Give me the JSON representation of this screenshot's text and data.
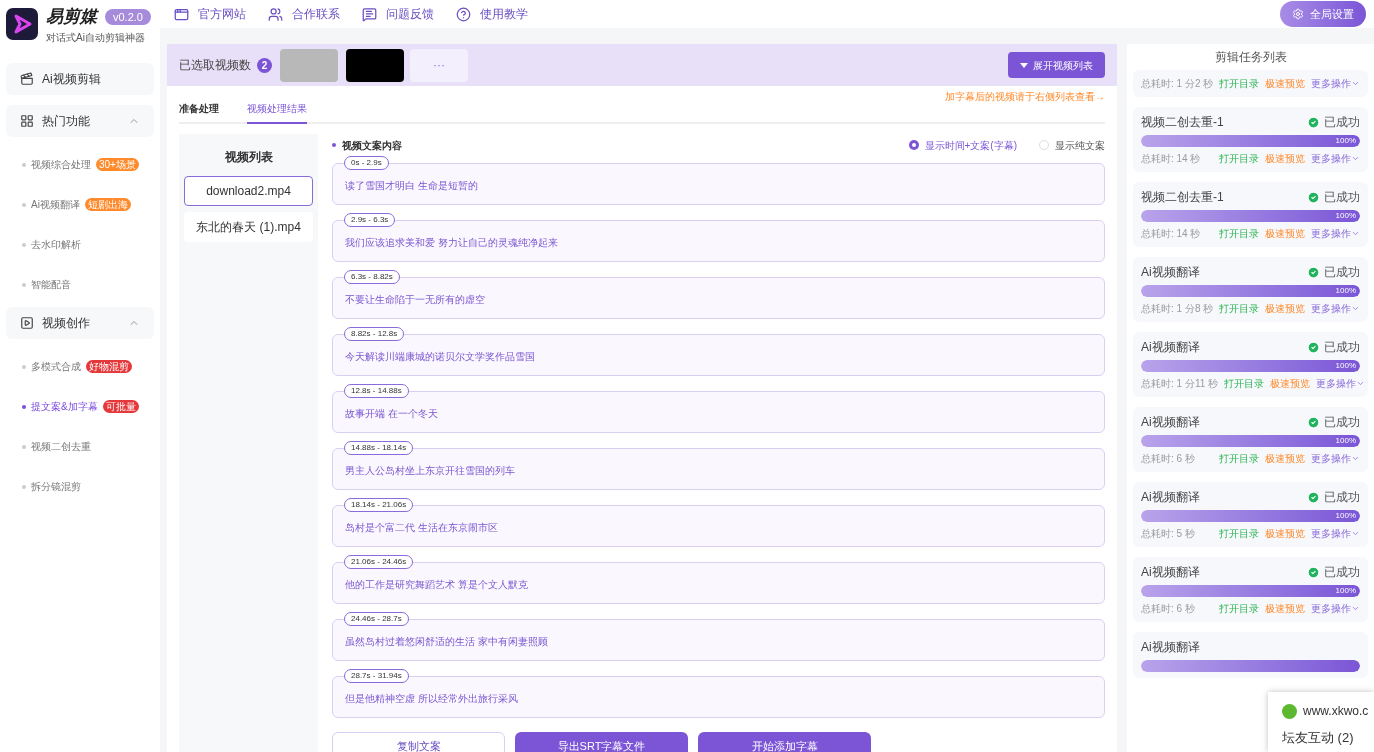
{
  "brand": {
    "name": "易剪媒",
    "version": "v0.2.0",
    "tagline": "对话式Ai自动剪辑神器"
  },
  "sidebar": [
    {
      "kind": "link",
      "label": "Ai视频剪辑"
    },
    {
      "kind": "group",
      "label": "热门功能",
      "expanded": true,
      "children": [
        {
          "label": "视频综合处理",
          "selected": false,
          "badge": "30+场景",
          "color": "#ff8a2b"
        },
        {
          "label": "Ai视频翻译",
          "selected": false,
          "badge": "短剧出海",
          "color": "#ff8a2b"
        },
        {
          "label": "去水印解析",
          "selected": false
        },
        {
          "label": "智能配音",
          "selected": false
        }
      ]
    },
    {
      "kind": "group",
      "label": "视频创作",
      "expanded": true,
      "children": [
        {
          "label": "多模式合成",
          "selected": false,
          "badge": "好物混剪",
          "color": "#e5383b"
        },
        {
          "label": "提文案&加字幕",
          "selected": true,
          "badge": "可批量",
          "color": "#e5383b"
        },
        {
          "label": "视频二创去重",
          "selected": false
        },
        {
          "label": "拆分镜混剪",
          "selected": false
        }
      ]
    }
  ],
  "topnav": [
    {
      "label": "官方网站"
    },
    {
      "label": "合作联系"
    },
    {
      "label": "问题反馈"
    },
    {
      "label": "使用教学"
    }
  ],
  "settings_button": "全局设置",
  "selection": {
    "label": "已选取视频数",
    "count": "2",
    "thumbnails": [
      {
        "kind": "photo"
      },
      {
        "kind": "dark"
      }
    ],
    "more": "···",
    "expand_button": "展开视频列表"
  },
  "tabs": [
    {
      "label": "准备处理",
      "selected": false
    },
    {
      "label": "视频处理结果",
      "selected": true
    }
  ],
  "hint": "加字幕后的视频请于右侧列表查看→",
  "video_list": {
    "title": "视频列表",
    "items": [
      {
        "label": "download2.mp4",
        "selected": true
      },
      {
        "label": "东北的春天 (1).mp4",
        "selected": false
      }
    ]
  },
  "transcript": {
    "title": "视频文案内容",
    "options": [
      {
        "label": "显示时间+文案(字幕)",
        "selected": true
      },
      {
        "label": "显示纯文案",
        "selected": false
      }
    ],
    "segments": [
      {
        "time": "0s - 2.9s",
        "text": "读了雪国才明白 生命是短暂的"
      },
      {
        "time": "2.9s - 6.3s",
        "text": "我们应该追求美和爱 努力让自己的灵魂纯净起来"
      },
      {
        "time": "6.3s - 8.82s",
        "text": "不要让生命陷于一无所有的虚空"
      },
      {
        "time": "8.82s - 12.8s",
        "text": "今天解读川端康城的诺贝尔文学奖作品雪国"
      },
      {
        "time": "12.8s - 14.88s",
        "text": "故事开端 在一个冬天"
      },
      {
        "time": "14.88s - 18.14s",
        "text": "男主人公岛村坐上东京开往雪国的列车"
      },
      {
        "time": "18.14s - 21.06s",
        "text": "岛村是个富二代 生活在东京闹市区"
      },
      {
        "time": "21.06s - 24.46s",
        "text": "他的工作是研究舞蹈艺术 算是个文人默克"
      },
      {
        "time": "24.46s - 28.7s",
        "text": "虽然岛村过着悠闲舒适的生活 家中有闲妻照顾"
      },
      {
        "time": "28.7s - 31.94s",
        "text": "但是他精神空虚 所以经常外出旅行采风"
      }
    ]
  },
  "actions": [
    {
      "kind": "outline",
      "label": "复制文案"
    },
    {
      "kind": "primary",
      "label": "导出SRT字幕文件"
    },
    {
      "kind": "primary",
      "label": "开始添加字幕"
    }
  ],
  "tasks": {
    "title": "剪辑任务列表",
    "items": [
      {
        "duration": "总耗时: 1 分2 秒",
        "open": "打开目录",
        "preview": "极速预览",
        "more": "更多操作"
      },
      {
        "name": "视频二创去重-1",
        "status": "已成功",
        "level": 1,
        "percent": "100%",
        "duration": "总耗时: 14 秒",
        "open": "打开目录",
        "preview": "极速预览",
        "more": "更多操作"
      },
      {
        "name": "视频二创去重-1",
        "status": "已成功",
        "level": 1,
        "percent": "100%",
        "duration": "总耗时: 14 秒",
        "open": "打开目录",
        "preview": "极速预览",
        "more": "更多操作"
      },
      {
        "name": "Ai视频翻译",
        "status": "已成功",
        "level": 1,
        "percent": "100%",
        "duration": "总耗时: 1 分8 秒",
        "open": "打开目录",
        "preview": "极速预览",
        "more": "更多操作"
      },
      {
        "name": "Ai视频翻译",
        "status": "已成功",
        "level": 1,
        "percent": "100%",
        "duration": "总耗时: 1 分11 秒",
        "open": "打开目录",
        "preview": "极速预览",
        "more": "更多操作"
      },
      {
        "name": "Ai视频翻译",
        "status": "已成功",
        "level": 1,
        "percent": "100%",
        "duration": "总耗时: 6 秒",
        "open": "打开目录",
        "preview": "极速预览",
        "more": "更多操作"
      },
      {
        "name": "Ai视频翻译",
        "status": "已成功",
        "level": 1,
        "percent": "100%",
        "duration": "总耗时: 5 秒",
        "open": "打开目录",
        "preview": "极速预览",
        "more": "更多操作"
      },
      {
        "name": "Ai视频翻译",
        "status": "已成功",
        "level": 1,
        "percent": "100%",
        "duration": "总耗时: 6 秒",
        "open": "打开目录",
        "preview": "极速预览",
        "more": "更多操作"
      },
      {
        "name": "Ai视频翻译",
        "level": 1
      }
    ]
  },
  "notification": {
    "site": "www.xkwo.c",
    "title": "坛友互动 (2)"
  }
}
